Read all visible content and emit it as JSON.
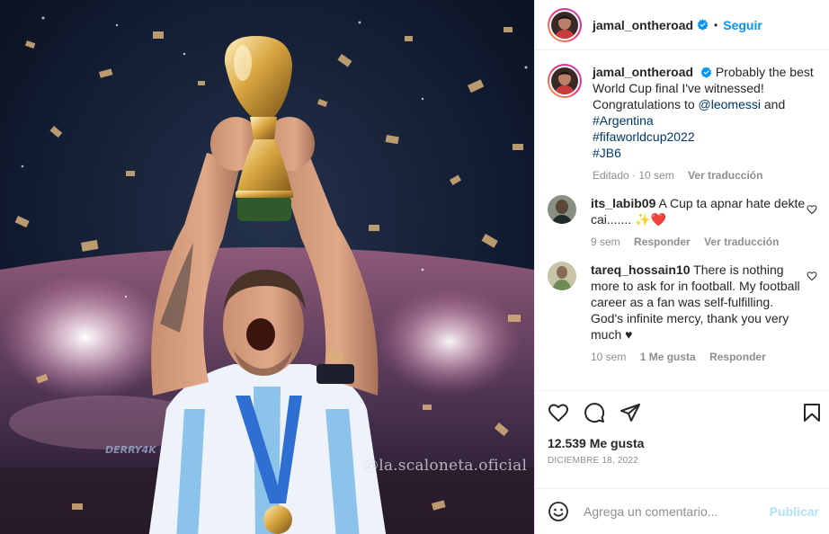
{
  "post": {
    "author": "jamal_ontheroad",
    "follow_label": "Seguir",
    "separator": "•",
    "verified_icon": "verified-badge-icon",
    "image_watermark": "@la.scaloneta.oficial",
    "image_artist_mark": "DERRY4K",
    "caption": {
      "username": "jamal_ontheroad",
      "text_1": "Probably the best World Cup final I've witnessed! Congratulations to",
      "mention": "@leomessi",
      "text_2": "and",
      "hashtags": [
        "#Argentina",
        "#fifaworldcup2022",
        "#JB6"
      ],
      "edited": "Editado",
      "time": "10 sem",
      "translate": "Ver traducción"
    },
    "comments": [
      {
        "username": "its_labib09",
        "text": "A Cup ta apnar hate dekte cai.......",
        "emoji": "✨❤️",
        "time": "9 sem",
        "reply": "Responder",
        "translate": "Ver traducción"
      },
      {
        "username": "tareq_hossain10",
        "text": "There is nothing more to ask for in football. My football career as a fan was self-fulfilling. God's infinite mercy, thank you very much ♥",
        "time": "10 sem",
        "likes": "1 Me gusta",
        "reply": "Responder"
      }
    ],
    "likes_count": "12.539 Me gusta",
    "date": "DICIEMBRE 18, 2022",
    "comment_placeholder": "Agrega un comentario...",
    "publish_label": "Publicar"
  },
  "colors": {
    "accent": "#0095f6",
    "link": "#00376b",
    "muted": "#8e8e8e",
    "publish_disabled": "#b2dffc",
    "border": "#efefef"
  },
  "icons": [
    "verified-badge-icon",
    "heart-icon",
    "comment-icon",
    "share-icon",
    "save-icon",
    "emoji-icon"
  ]
}
